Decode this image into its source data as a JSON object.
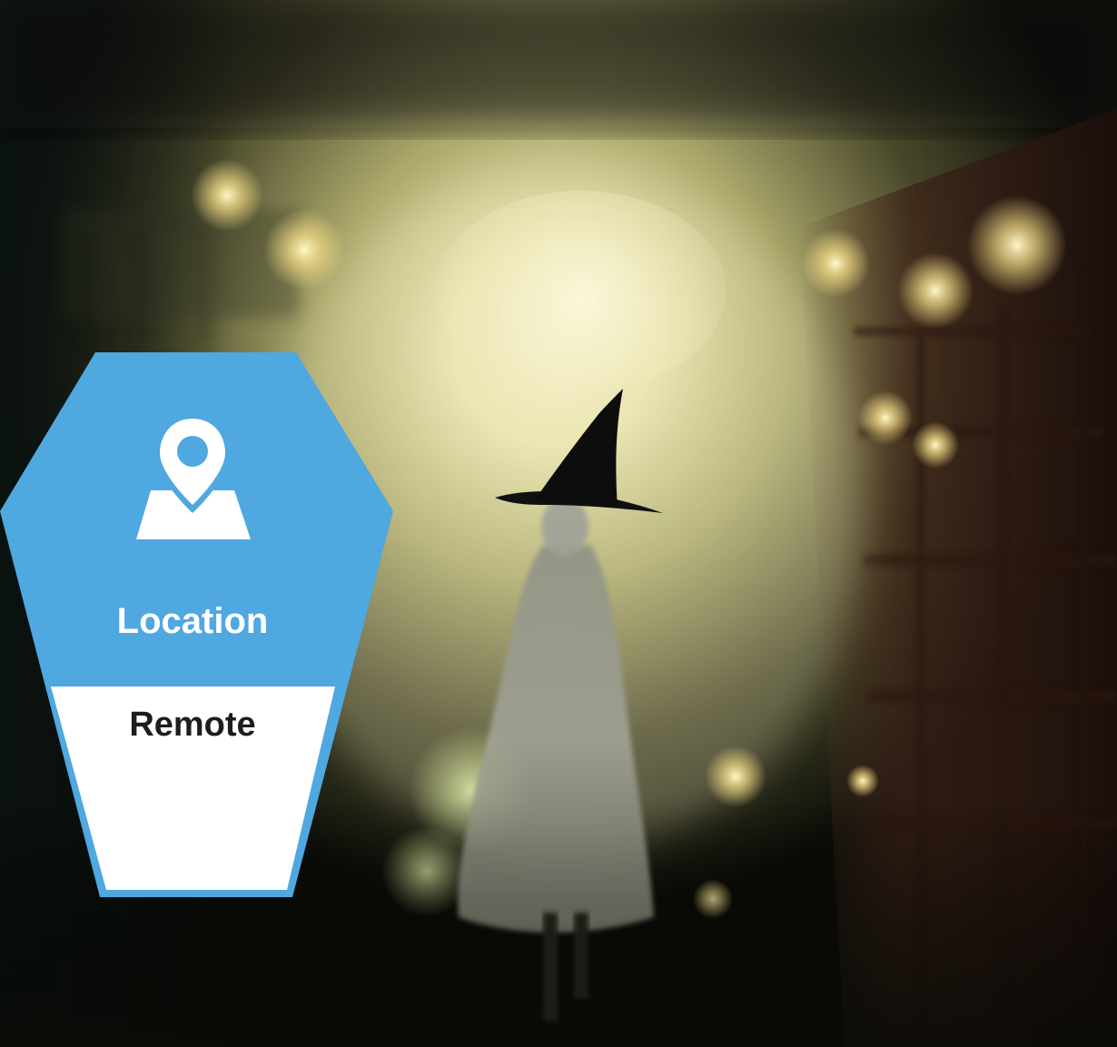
{
  "badge": {
    "icon": "map-pin-icon",
    "title": "Location",
    "value": "Remote",
    "colors": {
      "accent": "#4fa8e0",
      "title_text": "#ffffff",
      "value_text": "#1d1d1f",
      "value_bg": "#ffffff"
    }
  },
  "scene": {
    "subject": "witch-figure",
    "palette": {
      "glow": "#f4eebd",
      "haze": "#c9c78a",
      "dark": "#0d0f0a",
      "wood": "#3a1f15"
    }
  }
}
